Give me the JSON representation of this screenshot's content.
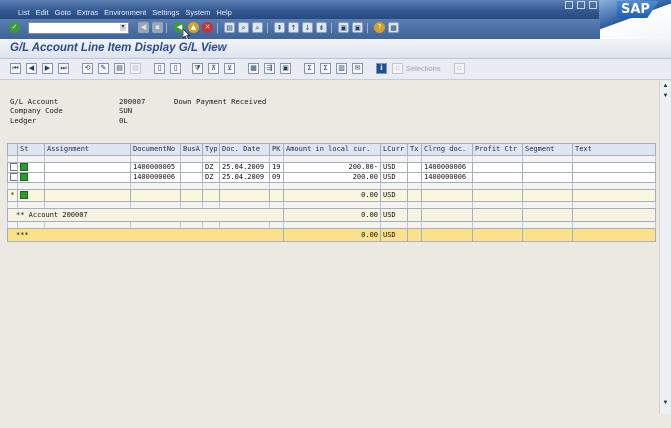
{
  "menu": {
    "items": [
      "List",
      "Edit",
      "Goto",
      "Extras",
      "Environment",
      "Settings",
      "System",
      "Help"
    ]
  },
  "logo_text": "SAP",
  "title": "G/L Account Line Item Display G/L View",
  "app_toolbar": {
    "selections_label": "Selections"
  },
  "header_fields": {
    "gl_account_label": "G/L Account",
    "gl_account_value": "200007",
    "gl_account_desc": "Down Payment Received",
    "company_code_label": "Company Code",
    "company_code_value": "SUN",
    "ledger_label": "Ledger",
    "ledger_value": "0L"
  },
  "grid": {
    "columns": [
      "St",
      "Assignment",
      "DocumentNo",
      "BusA",
      "Typ",
      "Doc. Date",
      "PK",
      "Amount in local cur.",
      "LCurr",
      "Tx",
      "Clrng doc.",
      "Profit Ctr",
      "Segment",
      "Text"
    ],
    "items": [
      {
        "docno": "1400000005",
        "typ": "DZ",
        "date": "25.04.2009",
        "pk": "19",
        "amount": "200.00-",
        "curr": "USD",
        "clrng": "1400000006"
      },
      {
        "docno": "1400000006",
        "typ": "DZ",
        "date": "25.04.2009",
        "pk": "09",
        "amount": "200.00",
        "curr": "USD",
        "clrng": "1400000006"
      }
    ],
    "subtotal": {
      "marker": "*",
      "amount": "0.00",
      "curr": "USD"
    },
    "account_total": {
      "label": "** Account 200007",
      "amount": "0.00",
      "curr": "USD"
    },
    "grand_total": {
      "marker": "***",
      "amount": "0.00",
      "curr": "USD"
    }
  }
}
